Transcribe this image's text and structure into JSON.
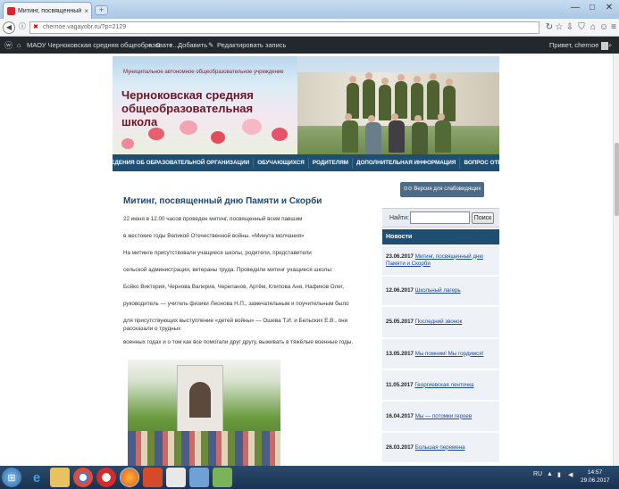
{
  "browser": {
    "tab_title": "Митинг, посвященный дню Па...",
    "tab_close": "×",
    "new_tab": "+",
    "minimize": "—",
    "maximize": "□",
    "close": "✕",
    "url": "chernoe.vagayobr.ru/?p=2129",
    "lock_glyph": "✖"
  },
  "admin_bar": {
    "site_name": "МАОУ Черноковская средняя общеобразовате...",
    "comments_count": "0",
    "add_label": "Добавить",
    "edit_label": "Редактировать запись",
    "greeting": "Привет, chernoe"
  },
  "header": {
    "subtitle": "Муниципальное автономное общеобразовательное учреждение",
    "title": "Черноковская средняя общеобразовательная школа"
  },
  "menu": [
    "СВЕДЕНИЯ ОБ ОБРАЗОВАТЕЛЬНОЙ ОРГАНИЗАЦИИ",
    "ОБУЧАЮЩИХСЯ",
    "РОДИТЕЛЯМ",
    "ДОПОЛНИТЕЛЬНАЯ ИНФОРМАЦИЯ",
    "ВОПРОС ОТВЕТ"
  ],
  "article": {
    "title": "Митинг, посвященный дню Памяти и Скорби",
    "paragraphs": [
      "22 июня в 12.00 часов проведен митинг, посвященный всем павшим",
      "в жестокие годы Великой Отечественной войны. «Минута молчания»",
      "На митинге присутствовали учащиеся школы, родители, представители",
      "сельской администрации, ветераны труда. Проведили митинг учащиеся школы:",
      "Бойко Виктория, Чернова Валерия, Черепанов, Артём, Клипова Аня, Нафиков Олег,",
      "руководитель — учитель физики Леонова Н.П., замечательным и поучительным было",
      "для присутствующих выступление «детей войны» — Ошева Т.И. и Бельских Е.В., они рассказали о трудных",
      "военных годах и о том как все помогали друг другу, выживать в тяжёлые военные годы."
    ]
  },
  "sidebar": {
    "visually_impaired": "Версия для слабовидящих",
    "search_label": "Найти:",
    "search_value": "",
    "search_button": "Поиск",
    "news_heading": "Новости",
    "news": [
      {
        "date": "23.06.2017",
        "title": "Митинг, посвященный дню Памяти и Скорби"
      },
      {
        "date": "12.06.2017",
        "title": "Школьный лагерь"
      },
      {
        "date": "25.05.2017",
        "title": "Последний звонок"
      },
      {
        "date": "13.05.2017",
        "title": "Мы помним! Мы гордимся!"
      },
      {
        "date": "11.05.2017",
        "title": "Георгиевская ленточка"
      },
      {
        "date": "16.04.2017",
        "title": "Мы — потомки героев"
      },
      {
        "date": "26.03.2017",
        "title": "Большая перемена"
      }
    ]
  },
  "taskbar": {
    "lang": "RU",
    "time": "14:57",
    "date": "29.06.2017"
  },
  "colors": {
    "nav_blue": "#1f4e73",
    "link_blue": "#1a4a9a",
    "title_maroon": "#6a1526"
  }
}
